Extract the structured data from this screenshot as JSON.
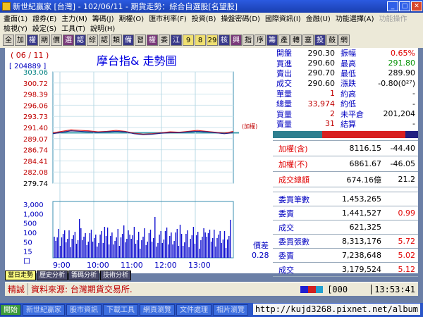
{
  "window": {
    "title": "新世紀贏家 [台灣] - 102/06/11 - 期貨走勢：綜合自選股[名望股]"
  },
  "menu": {
    "row1": [
      "畫面(1)",
      "證券(E)",
      "主力(M)",
      "籌碼(J)",
      "期權(O)",
      "匯市利率(F)",
      "投資(B)",
      "操盤密碼(D)",
      "國際資訊(I)",
      "金融(U)",
      "功能選擇(A)",
      "功能操作"
    ],
    "row2": [
      "檢視(Y)",
      "設定(S)",
      "工具(T)",
      "說明(H)"
    ]
  },
  "toolbar": [
    "全",
    "加",
    "權",
    "期",
    "價",
    "選",
    "認",
    "綜",
    "認",
    "類",
    "備",
    "習",
    "權",
    "委",
    "江",
    "9",
    "8",
    "29",
    "核",
    "興",
    "指",
    "序",
    "籌",
    "產",
    "轉",
    "塞",
    "投",
    "鼓",
    "網"
  ],
  "chart": {
    "header_date": "( 06 / 11 )",
    "title": "摩台指& 走勢圖",
    "contract_code": "[ 204889 ]",
    "price_labels": [
      "303.06",
      "300.72",
      "298.39",
      "296.06",
      "293.73",
      "291.40",
      "289.07",
      "286.74",
      "284.41",
      "282.08",
      "279.74"
    ],
    "ref_label": "(加權)",
    "volume_labels": [
      "3,000",
      "1,000",
      "500",
      "100",
      "50",
      "15",
      "口"
    ],
    "time_labels": [
      "9:00",
      "10:00",
      "11:00",
      "12:00",
      "13:00"
    ],
    "spread_label": "價差",
    "spread_value": "0.28"
  },
  "chart_data": {
    "type": "line",
    "ylim": [
      279.74,
      303.06
    ],
    "x": [
      "8:45",
      "9:00",
      "9:15",
      "9:30",
      "9:45",
      "10:00",
      "10:15",
      "10:30",
      "10:45",
      "11:00",
      "11:15",
      "11:30",
      "11:45",
      "12:00",
      "12:15",
      "12:30",
      "12:45",
      "13:00",
      "13:15",
      "13:30",
      "13:45"
    ],
    "series": [
      {
        "values": [
          290.3,
          290.6,
          290.9,
          290.8,
          290.7,
          290.5,
          290.6,
          290.8,
          290.6,
          290.2,
          290.0,
          290.1,
          290.3,
          290.5,
          290.4,
          290.6,
          290.8,
          290.6,
          290.4,
          290.2,
          290.6
        ]
      },
      {
        "values": [
          290.1,
          290.4,
          290.7,
          290.6,
          290.5,
          290.4,
          290.5,
          290.6,
          290.5,
          290.1,
          289.9,
          290.0,
          290.2,
          290.3,
          290.3,
          290.5,
          290.6,
          290.5,
          290.3,
          290.1,
          290.3
        ]
      }
    ]
  },
  "quote": {
    "rows": [
      {
        "l1": "開盤",
        "v1": "290.30",
        "l2": "振幅",
        "v2": "0.65%",
        "c2": "red"
      },
      {
        "l1": "買進",
        "v1": "290.60",
        "l2": "最高",
        "v2": "291.80",
        "c2": "green"
      },
      {
        "l1": "賣出",
        "v1": "290.70",
        "l2": "最低",
        "v2": "289.90",
        "c2": "black"
      },
      {
        "l1": "成交",
        "v1": "290.60",
        "l2": "漲跌",
        "v2": "-0.80(0²⁷)",
        "c2": "black"
      },
      {
        "l1": "單量",
        "v1": "1",
        "l2": "約高",
        "v2": "-",
        "c2": "black"
      },
      {
        "l1": "總量",
        "v1": "33,974",
        "l2": "約低",
        "v2": "-",
        "c2": "black"
      },
      {
        "l1": "買量",
        "v1": "2",
        "l2": "未平倉",
        "v2": "201,204",
        "c2": "black"
      },
      {
        "l1": "賣量",
        "v1": "31",
        "l2": "結算",
        "v2": "-",
        "c2": "black"
      }
    ],
    "index_rows": [
      {
        "label": "加權(含)",
        "value": "8116.15",
        "change": "-44.40"
      },
      {
        "label": "加權(不)",
        "value": "6861.67",
        "change": "-46.05"
      },
      {
        "label": "成交總額",
        "value": "674.16億",
        "change": "21.2"
      }
    ],
    "order_rows": [
      {
        "label": "委買筆數",
        "value": "1,453,265",
        "ratio": ""
      },
      {
        "label": "委賣",
        "value": "1,441,527",
        "ratio": "0.99"
      },
      {
        "label": "成交",
        "value": "621,325",
        "ratio": ""
      },
      {
        "label": "委買張數",
        "value": "8,313,176",
        "ratio": "5.72"
      },
      {
        "label": "委賣",
        "value": "7,238,648",
        "ratio": "5.02"
      },
      {
        "label": "成交",
        "value": "3,179,524",
        "ratio": "5.12"
      }
    ]
  },
  "tabs": [
    "當日走勢",
    "歷史分析",
    "籌碼分析",
    "技術分析"
  ],
  "status": {
    "label": "精誠",
    "source": "資料來源: 台灣期貨交易所.",
    "code": "[000",
    "time": "13:53:41"
  },
  "taskbar": [
    "開始",
    "新世紀贏家",
    "股市資訊",
    "下載工具",
    "網頁瀏覽",
    "文件處理",
    "相片瀏覽"
  ],
  "footer_url": "http://kujd3268.pixnet.net/album"
}
